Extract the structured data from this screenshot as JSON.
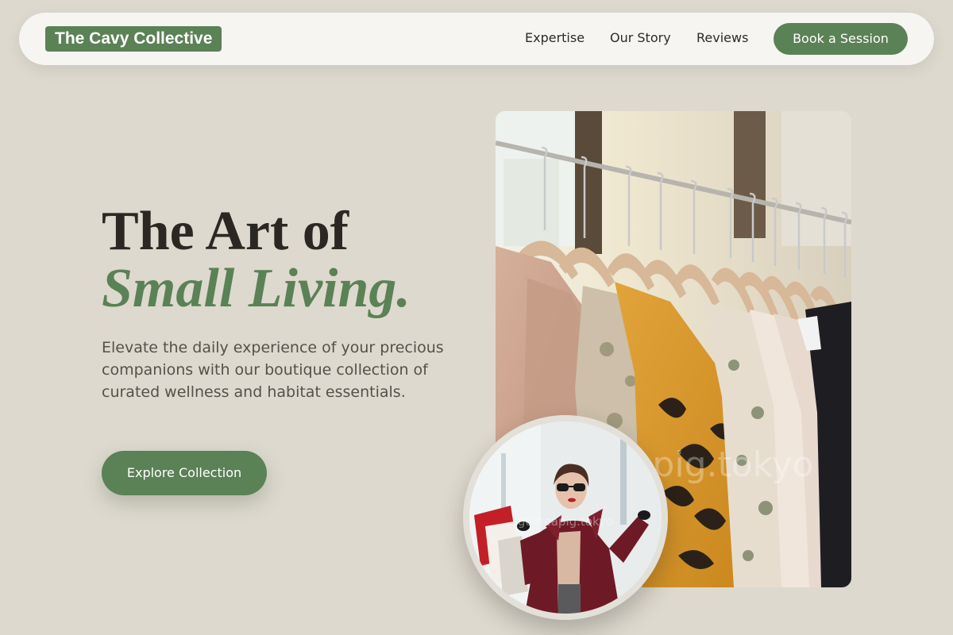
{
  "header": {
    "brand": "The Cavy Collective",
    "nav": {
      "expertise": "Expertise",
      "story": "Our Story",
      "reviews": "Reviews"
    },
    "cta_label": "Book a Session"
  },
  "hero": {
    "title_line1": "The Art of",
    "title_line2": "Small Living.",
    "body": "Elevate the daily experience of your precious companions with our boutique collection of curated wellness and habitat essentials.",
    "button_label": "Explore Collection"
  },
  "images": {
    "main_watermark": "guineapig.tokyo",
    "circle_watermark": "guineapig.tokyo"
  },
  "colors": {
    "background": "#ddd9ce",
    "accent": "#5b8156",
    "nav_background": "#f6f5f2",
    "heading": "#2b2824"
  }
}
